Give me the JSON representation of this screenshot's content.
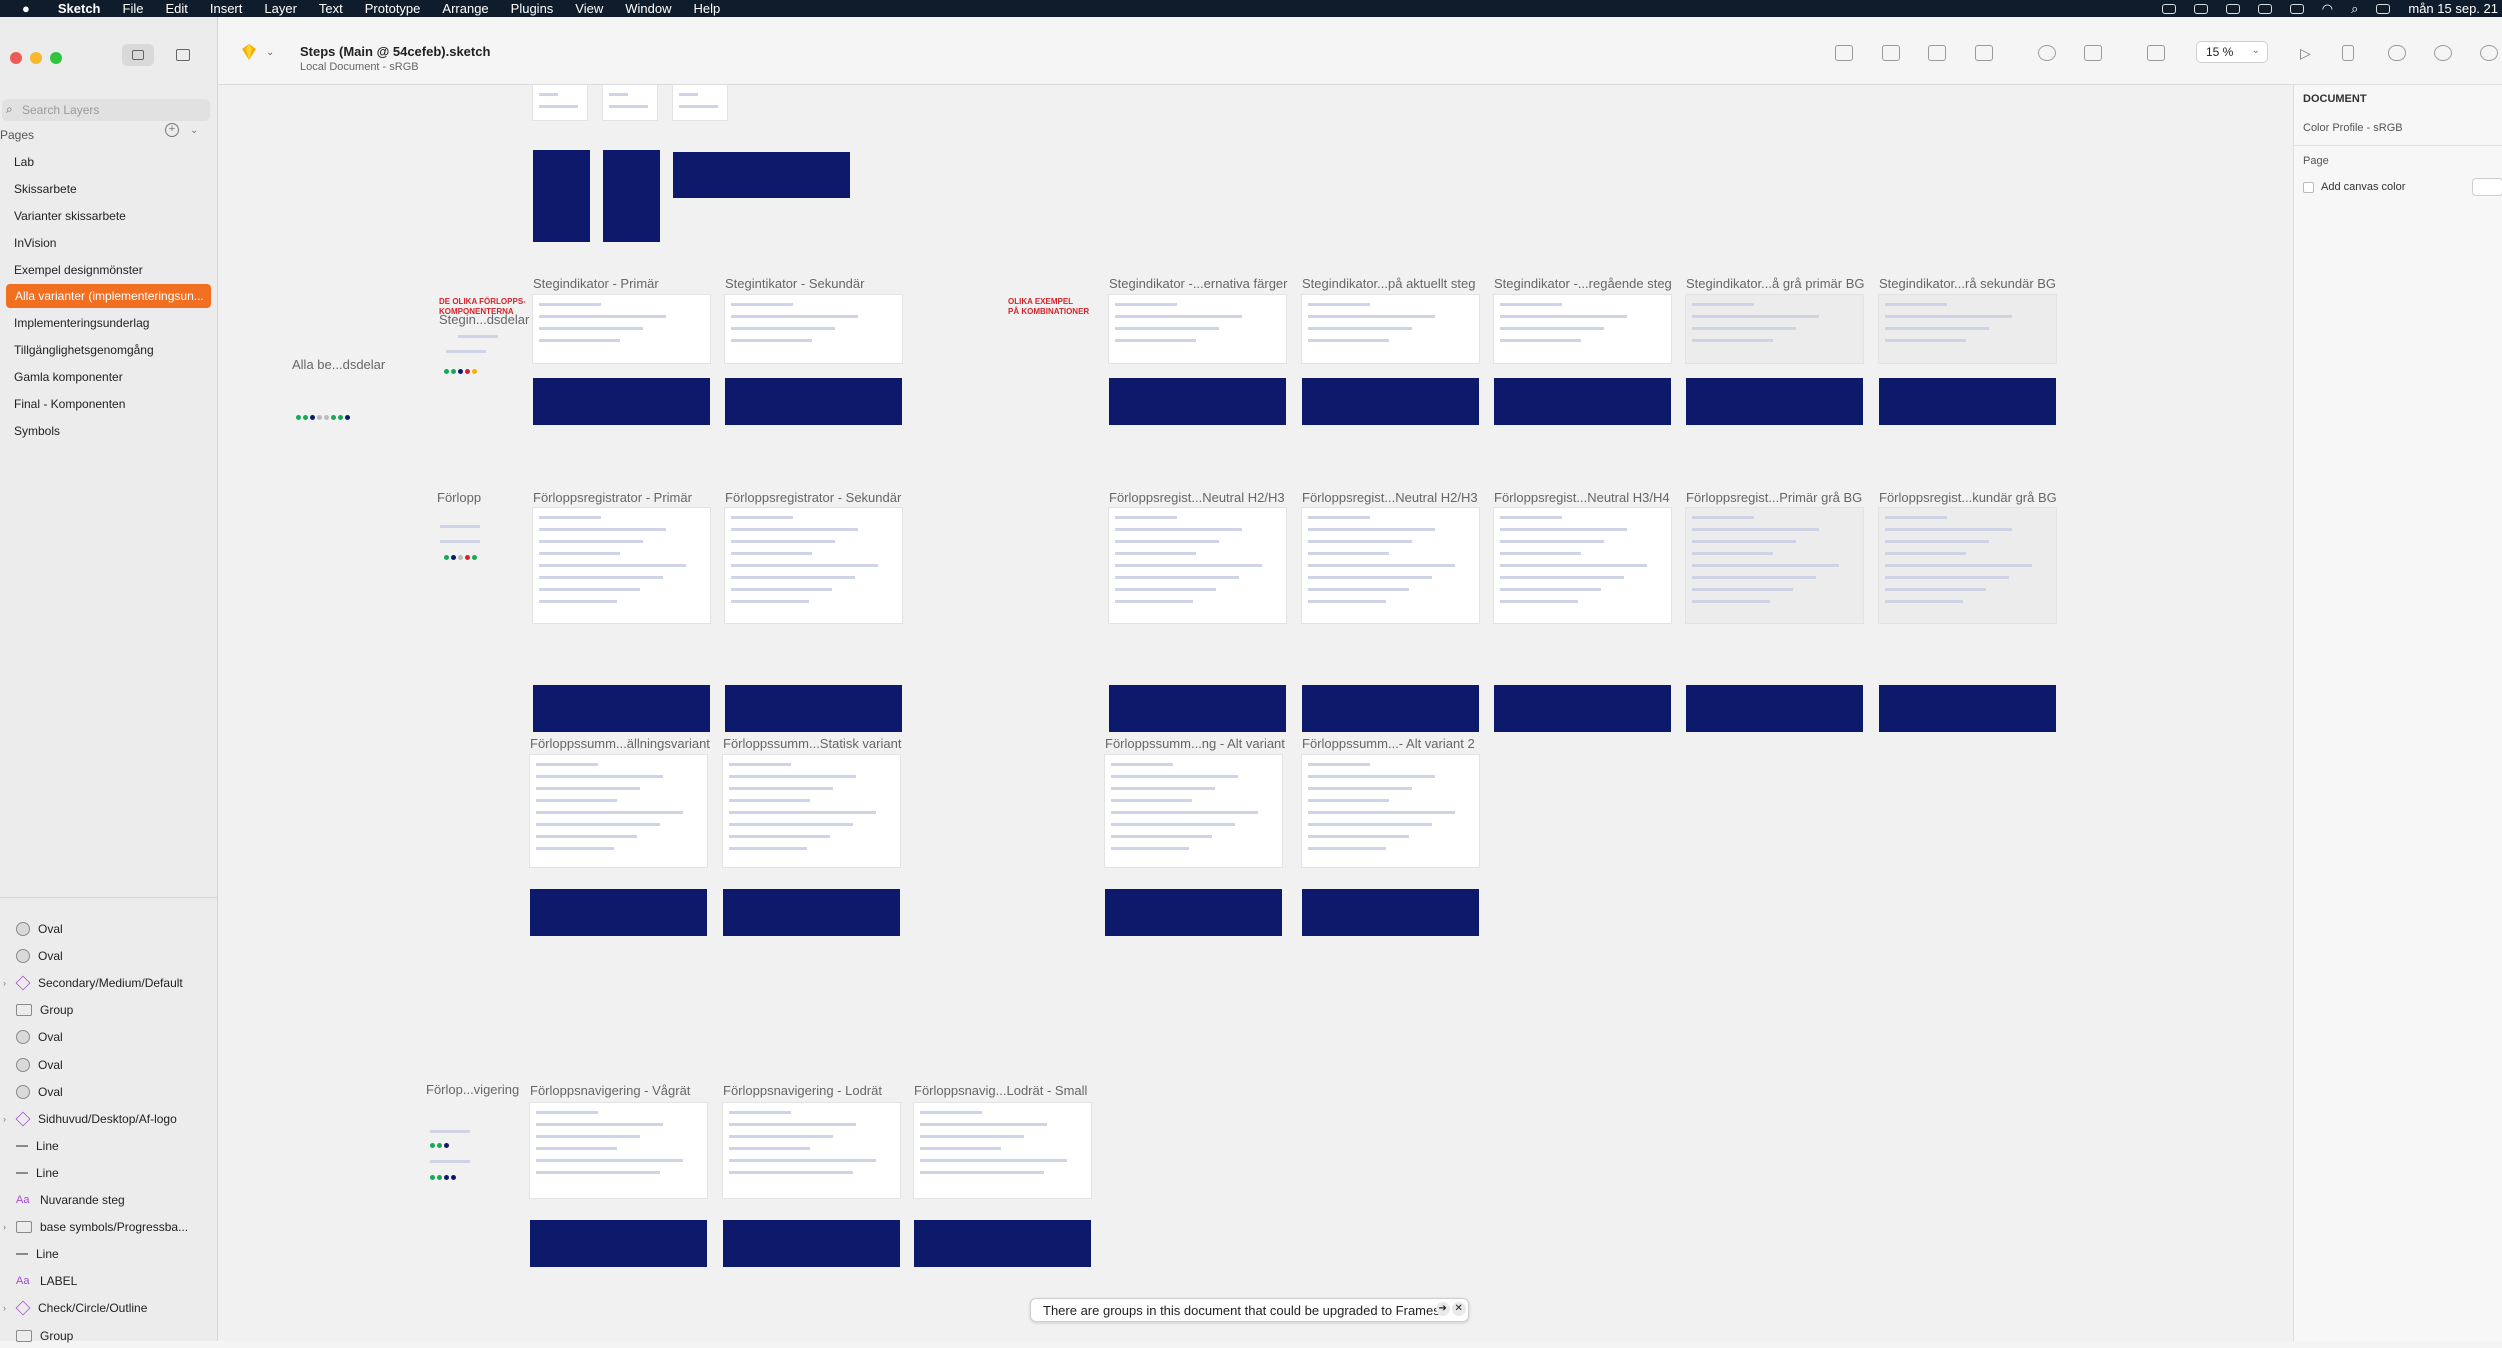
{
  "menubar": {
    "app": "Sketch",
    "items": [
      "File",
      "Edit",
      "Insert",
      "Layer",
      "Text",
      "Prototype",
      "Arrange",
      "Plugins",
      "View",
      "Window",
      "Help"
    ],
    "clock": "mån 15 sep. 21"
  },
  "document": {
    "title": "Steps (Main @ 54cefeb).sketch",
    "subtitle": "Local Document - sRGB"
  },
  "toolbar": {
    "zoom": "15 %"
  },
  "sidebar": {
    "search_placeholder": "Search Layers",
    "pages_label": "Pages",
    "pages": [
      {
        "label": "Lab",
        "selected": false
      },
      {
        "label": "Skissarbete",
        "selected": false
      },
      {
        "label": "Varianter skissarbete",
        "selected": false
      },
      {
        "label": "InVision",
        "selected": false
      },
      {
        "label": "Exempel designmönster",
        "selected": false
      },
      {
        "label": "Alla varianter (implementeringsun...",
        "selected": true
      },
      {
        "label": "Implementeringsunderlag",
        "selected": false
      },
      {
        "label": "Tillgänglighetsgenomgång",
        "selected": false
      },
      {
        "label": "Gamla komponenter",
        "selected": false
      },
      {
        "label": "Final - Komponenten",
        "selected": false
      },
      {
        "label": "Symbols",
        "selected": false
      }
    ],
    "layers": [
      {
        "label": "Oval",
        "icon": "oval-icon",
        "chevron": false
      },
      {
        "label": "Oval",
        "icon": "oval-icon",
        "chevron": false
      },
      {
        "label": "Secondary/Medium/Default",
        "icon": "symbol-icon",
        "chevron": true
      },
      {
        "label": "Group",
        "icon": "folder-icon",
        "chevron": false
      },
      {
        "label": "Oval",
        "icon": "oval-icon",
        "chevron": false
      },
      {
        "label": "Oval",
        "icon": "oval-icon",
        "chevron": false
      },
      {
        "label": "Oval",
        "icon": "oval-icon",
        "chevron": false
      },
      {
        "label": "Sidhuvud/Desktop/Af-logo",
        "icon": "symbol-icon",
        "chevron": true
      },
      {
        "label": "Line",
        "icon": "line-icon",
        "chevron": false
      },
      {
        "label": "Line",
        "icon": "line-icon",
        "chevron": false
      },
      {
        "label": "Nuvarande steg",
        "icon": "text-icon",
        "chevron": false
      },
      {
        "label": "base symbols/Progressba...",
        "icon": "folder-icon",
        "chevron": true
      },
      {
        "label": "Line",
        "icon": "line-icon",
        "chevron": false
      },
      {
        "label": "LABEL",
        "icon": "text-icon",
        "chevron": false
      },
      {
        "label": "Check/Circle/Outline",
        "icon": "symbol-icon",
        "chevron": true
      },
      {
        "label": "Group",
        "icon": "folder-icon",
        "chevron": false
      }
    ]
  },
  "inspector": {
    "section": "DOCUMENT",
    "color_profile": "Color Profile - sRGB",
    "page_label": "Page",
    "canvas_color": "Add canvas color"
  },
  "canvas": {
    "notes": [
      "DE OLIKA FÖRLOPPS-\nKOMPONENTERNA",
      "OLIKA EXEMPEL\nPÅ KOMBINATIONER"
    ],
    "group_labels": [
      "Alla be...dsdelar",
      "Stegin...dsdelar",
      "Förlopp",
      "Förlop...vigering"
    ],
    "row1": [
      "Stegindikator - Primär",
      "Stegintikator - Sekundär",
      "Stegindikator -...ernativa färger",
      "Stegindikator...på aktuellt steg",
      "Stegindikator -...regående steg",
      "Stegindikator...å grå primär BG",
      "Stegindikator...rå sekundär BG"
    ],
    "row2": [
      "Förloppsregistrator - Primär",
      "Förloppsregistrator - Sekundär",
      "Förloppsregist...Neutral H2/H3",
      "Förloppsregist...Neutral H2/H3",
      "Förloppsregist...Neutral H3/H4",
      "Förloppsregist...Primär grå BG",
      "Förloppsregist...kundär grå BG"
    ],
    "row3": [
      "Förloppssumm...ällningsvariant",
      "Förloppssumm...Statisk variant",
      "Förloppssumm...ng - Alt variant",
      "Förloppssumm...- Alt variant 2"
    ],
    "row4": [
      "Förloppsnavigering - Vågrät",
      "Förloppsnavigering - Lodrät",
      "Förloppsnavig...Lodrät - Small"
    ]
  },
  "toast": {
    "text": "There are groups in this document that could be upgraded to Frames"
  },
  "colors": {
    "accent": "#f26f22",
    "navy": "#0d1a6b",
    "warning": "#d8232a"
  }
}
